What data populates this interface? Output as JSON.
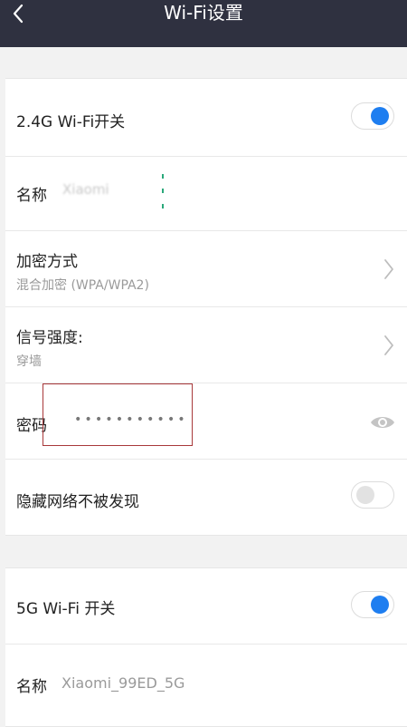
{
  "header": {
    "title": "Wi-Fi设置",
    "back_icon": "back-arrow-icon"
  },
  "band24": {
    "switch_label": "2.4G Wi-Fi开关",
    "switch_on": true,
    "name_label": "名称",
    "name_value": "Xiaomi",
    "encryption_label": "加密方式",
    "encryption_value": "混合加密 (WPA/WPA2)",
    "signal_label": "信号强度:",
    "signal_value": "穿墙",
    "password_label": "密码",
    "password_mask": "•••••••••••",
    "hidden_label": "隐藏网络不被发现",
    "hidden_on": false
  },
  "band5": {
    "switch_label": "5G Wi-Fi 开关",
    "switch_on": true,
    "name_label": "名称",
    "name_value": "Xiaomi_99ED_5G"
  },
  "colors": {
    "header": "#2f3140",
    "accent": "#1e7ef0",
    "highlight_box": "#a8383a"
  }
}
